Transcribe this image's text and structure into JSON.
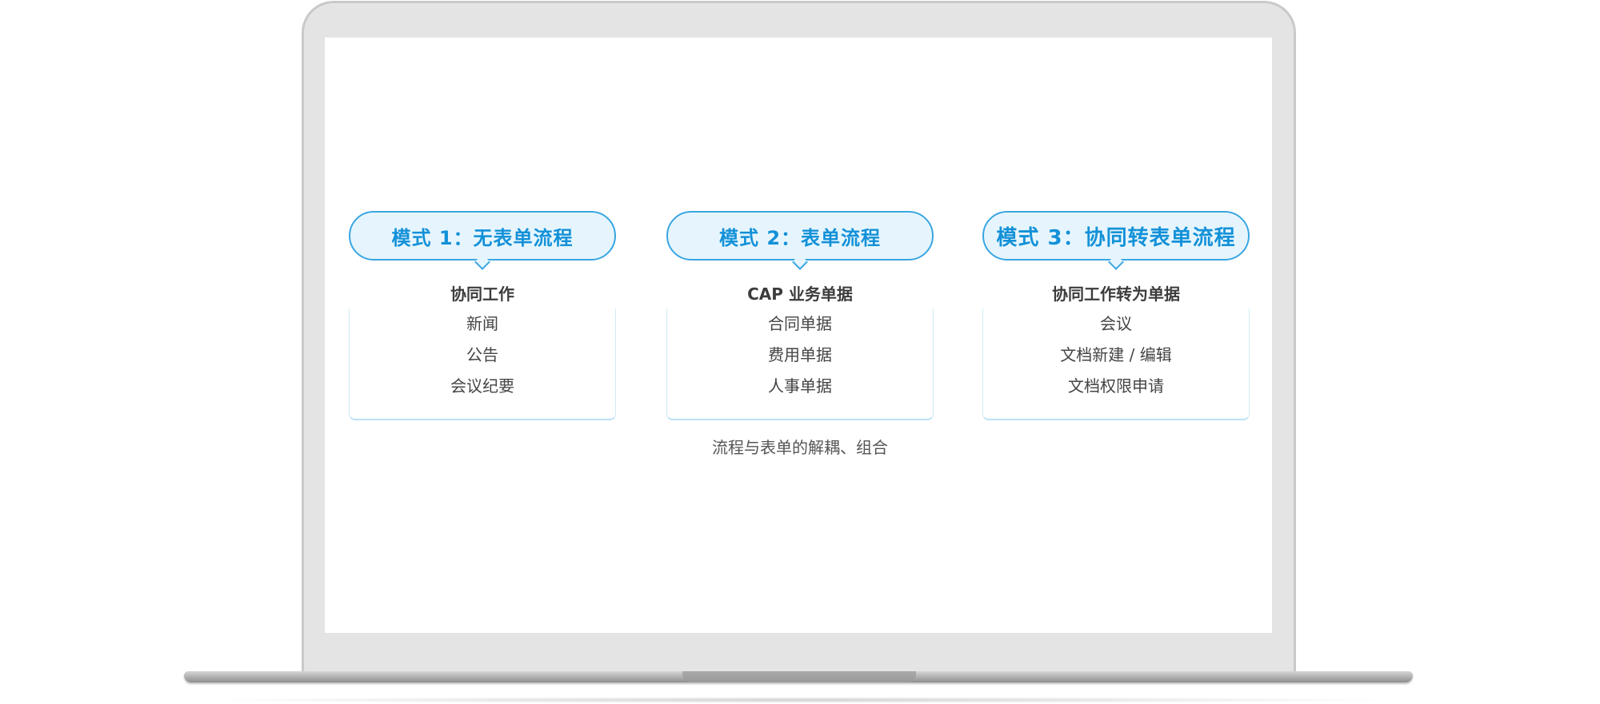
{
  "modes": [
    {
      "title": "模式 1：无表单流程",
      "head": "协同工作",
      "items": [
        "新闻",
        "公告",
        "会议纪要"
      ]
    },
    {
      "title": "模式 2：表单流程",
      "head": "CAP 业务单据",
      "items": [
        "合同单据",
        "费用单据",
        "人事单据"
      ]
    },
    {
      "title": "模式 3：协同转表单流程",
      "head": "协同工作转为单据",
      "items": [
        "会议",
        "文档新建 / 编辑",
        "文档权限申请"
      ]
    }
  ],
  "caption": "流程与表单的解耦、组合",
  "colors": {
    "accent": "#1391d8",
    "pill_bg": "#e6f5fd",
    "pill_border": "#3aa6e2"
  }
}
